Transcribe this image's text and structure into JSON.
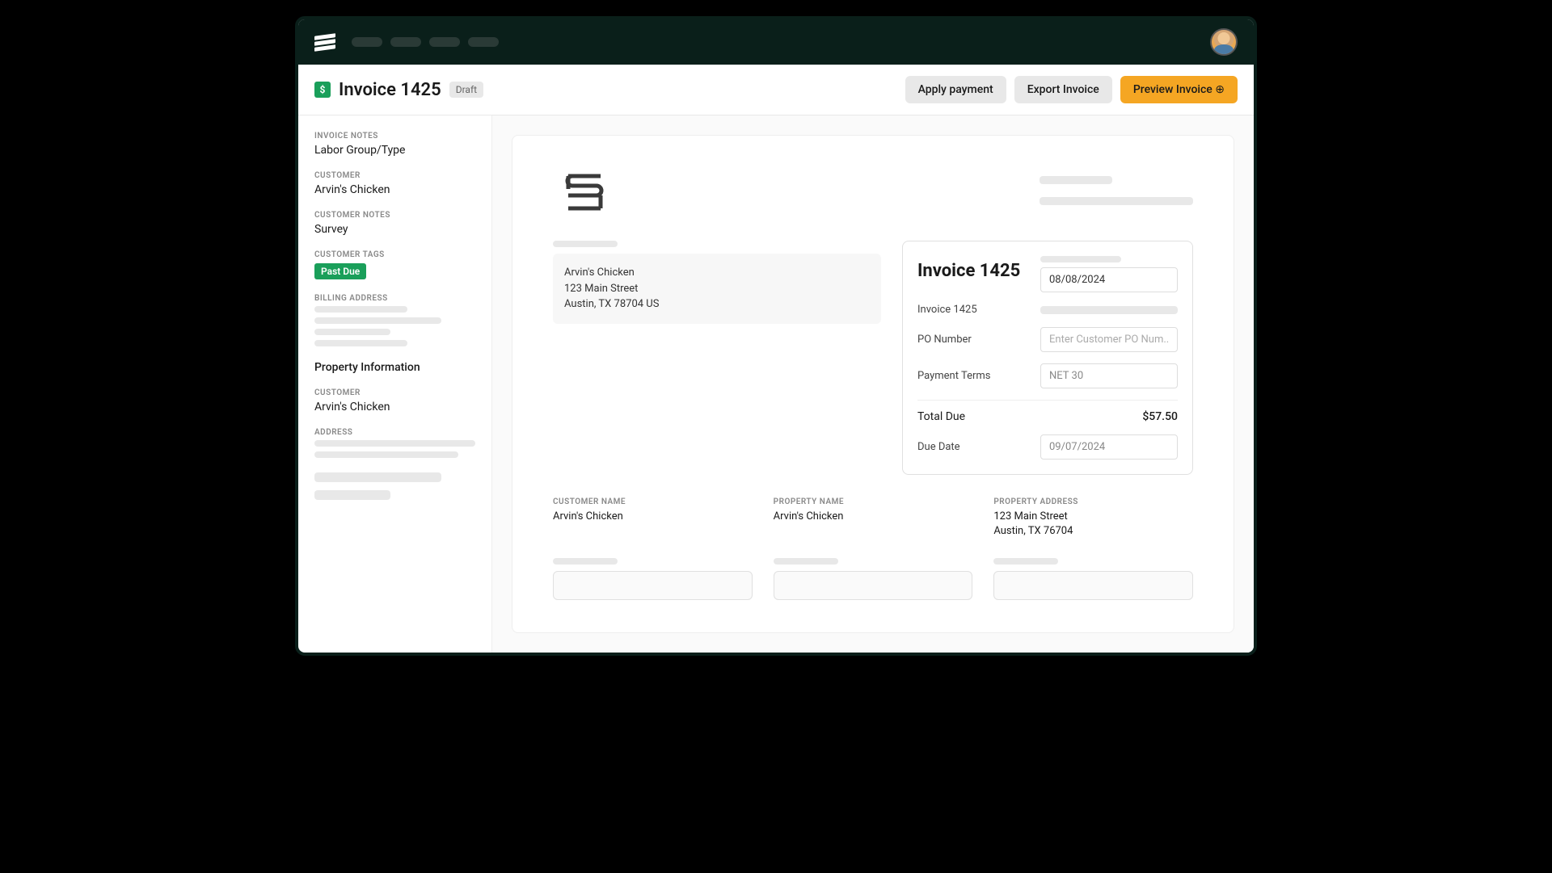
{
  "header": {
    "title": "Invoice 1425",
    "status": "Draft",
    "apply_payment": "Apply payment",
    "export": "Export Invoice",
    "preview": "Preview Invoice ⊕"
  },
  "sidebar": {
    "invoice_notes_label": "INVOICE NOTES",
    "invoice_notes_value": "Labor Group/Type",
    "customer_label": "CUSTOMER",
    "customer_value": "Arvin's Chicken",
    "customer_notes_label": "CUSTOMER NOTES",
    "customer_notes_value": "Survey",
    "customer_tags_label": "CUSTOMER TAGS",
    "tag": "Past Due",
    "billing_address_label": "BILLING ADDRESS",
    "property_info": "Property Information",
    "prop_customer_label": "CUSTOMER",
    "prop_customer_value": "Arvin's Chicken",
    "address_label": "ADDRESS"
  },
  "invoice": {
    "bill_to": {
      "name": "Arvin's Chicken",
      "street": "123 Main Street",
      "city": "Austin, TX 78704 US"
    },
    "box": {
      "title": "Invoice 1425",
      "date": "08/08/2024",
      "invoice_num": "Invoice 1425",
      "po_label": "PO Number",
      "po_placeholder": "Enter Customer PO Num...",
      "terms_label": "Payment Terms",
      "terms_value": "NET 30",
      "total_label": "Total Due",
      "total_value": "$57.50",
      "due_label": "Due Date",
      "due_value": "09/07/2024"
    },
    "details": {
      "customer_name_label": "CUSTOMER NAME",
      "customer_name": "Arvin's Chicken",
      "property_name_label": "PROPERTY NAME",
      "property_name": "Arvin's Chicken",
      "property_address_label": "PROPERTY ADDRESS",
      "property_address_1": "123 Main Street",
      "property_address_2": "Austin, TX 76704"
    }
  }
}
